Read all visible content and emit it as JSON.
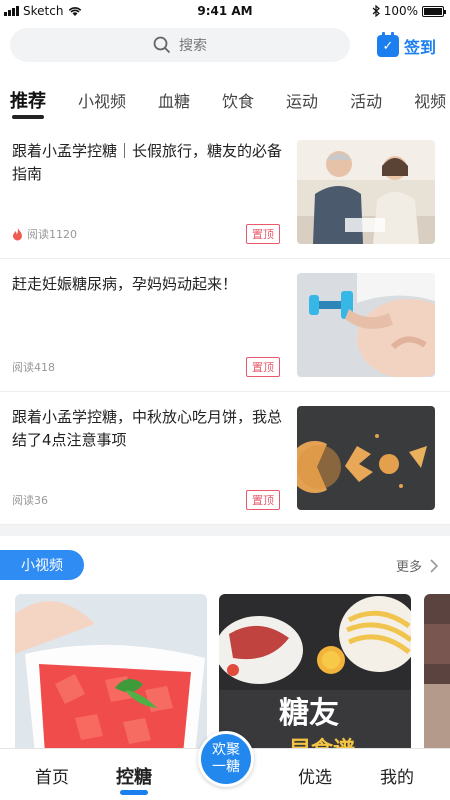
{
  "status_bar": {
    "carrier": "Sketch",
    "time": "9:41 AM",
    "battery": "100%"
  },
  "header": {
    "search_placeholder": "搜索",
    "checkin_label": "签到",
    "tabs": [
      "推荐",
      "小视频",
      "血糖",
      "饮食",
      "运动",
      "活动",
      "视频"
    ],
    "active_tab": "推荐"
  },
  "articles": [
    {
      "title": "跟着小孟学控糖｜长假旅行，糖友的必备指南",
      "reads": "阅读1120",
      "badge": "置顶",
      "hot": true
    },
    {
      "title": "赶走妊娠糖尿病，孕妈妈动起来！",
      "reads": "阅读418",
      "badge": "置顶",
      "hot": false
    },
    {
      "title": "跟着小孟学控糖，中秋放心吃月饼，我总结了4点注意事项",
      "reads": "阅读36",
      "badge": "置顶",
      "hot": false
    }
  ],
  "video_section": {
    "title": "小视频",
    "more_label": "更多",
    "card2_overlay": "糖友",
    "card2_overlay_sub": "早食谱"
  },
  "bottom_nav": {
    "items": [
      "首页",
      "控糖",
      "优选",
      "我的"
    ],
    "active": "控糖",
    "fab_line1": "欢聚",
    "fab_line2": "一糖"
  },
  "colors": {
    "accent": "#1c7ff0",
    "badge": "#e85a6b"
  }
}
